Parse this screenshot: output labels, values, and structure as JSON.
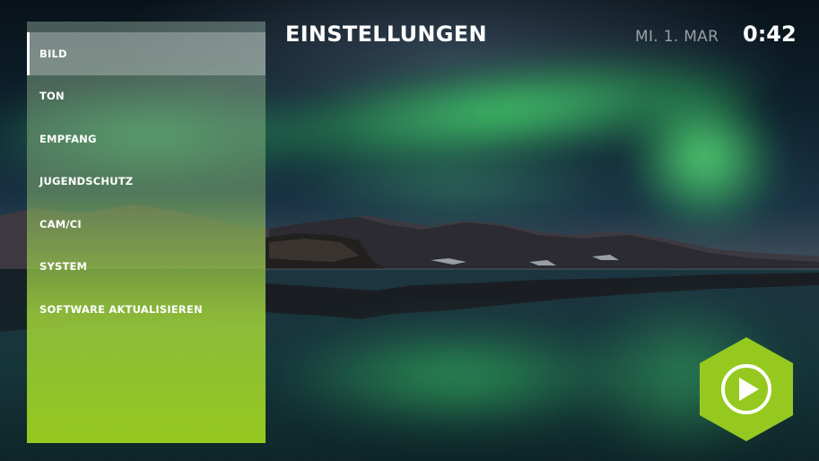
{
  "header": {
    "title": "EINSTELLUNGEN",
    "date": "MI. 1. MAR",
    "time": "0:42"
  },
  "menu": {
    "selected_index": 0,
    "items": [
      {
        "label": "BILD"
      },
      {
        "label": "TON"
      },
      {
        "label": "EMPFANG"
      },
      {
        "label": "JUGENDSCHUTZ"
      },
      {
        "label": "CAM/CI"
      },
      {
        "label": "SYSTEM"
      },
      {
        "label": "SOFTWARE AKTUALISIEREN"
      }
    ]
  },
  "play_button": {
    "icon": "play-icon"
  },
  "colors": {
    "accent": "#95c91f",
    "text": "#ffffff",
    "date_text": "#9aa7a8"
  }
}
